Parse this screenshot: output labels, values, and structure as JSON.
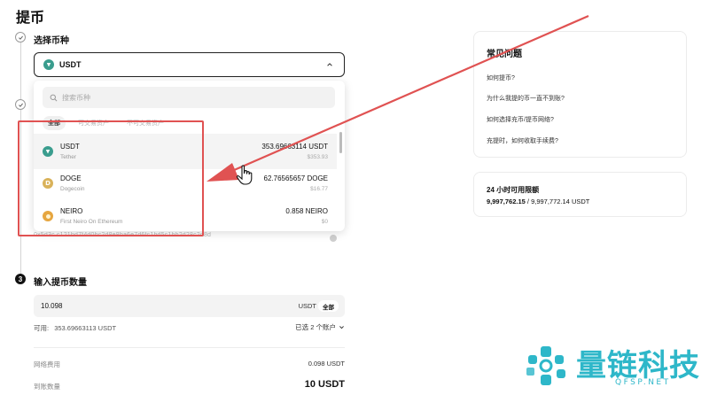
{
  "page": {
    "title": "提币"
  },
  "steps": {
    "step1_label": "选择币种",
    "step3_num": "3",
    "step3_label": "输入提币数量"
  },
  "coin_select": {
    "selected": "USDT"
  },
  "dropdown": {
    "search_placeholder": "搜索币种",
    "filters": [
      "全部",
      "可交易资产",
      "不可交易资产"
    ],
    "coins": [
      {
        "symbol": "USDT",
        "name": "Tether",
        "balance": "353.69663114 USDT",
        "value": "$353.93"
      },
      {
        "symbol": "DOGE",
        "name": "Dogecoin",
        "balance": "62.76565657 DOGE",
        "value": "$16.77"
      },
      {
        "symbol": "NEIRO",
        "name": "First Neiro On Ethereum",
        "balance": "0.858 NEIRO",
        "value": "$0"
      }
    ]
  },
  "address": {
    "partial": "0x5d3c.c121bd7f4d0bc2d8e8ba6e7d6fc1bd5c1bb2d28c2d8d"
  },
  "amount": {
    "value": "10.098",
    "unit": "USDT",
    "all_label": "全部",
    "available_label": "可用:",
    "available_value": "353.69663113 USDT",
    "accounts_label": "已选 2 个账户"
  },
  "fee": {
    "label": "网络费用",
    "value": "0.098 USDT"
  },
  "receive": {
    "label": "到账数量",
    "value": "10 USDT"
  },
  "faq": {
    "title": "常见问题",
    "items": [
      "如何提币?",
      "为什么我提的币一直不到账?",
      "如何选择充币/提币网络?",
      "充提时，如何收取手续费?"
    ]
  },
  "limit": {
    "title": "24 小时可用限额",
    "used": "9,997,762.15",
    "separator": " / ",
    "total": "9,997,772.14 USDT"
  },
  "watermark": {
    "text": "量链科技",
    "url": "QFSP.NET"
  },
  "colors": {
    "annotation_red": "#e05252",
    "watermark_teal": "#2eb7c9",
    "usdt_green": "#3a9d8e"
  }
}
